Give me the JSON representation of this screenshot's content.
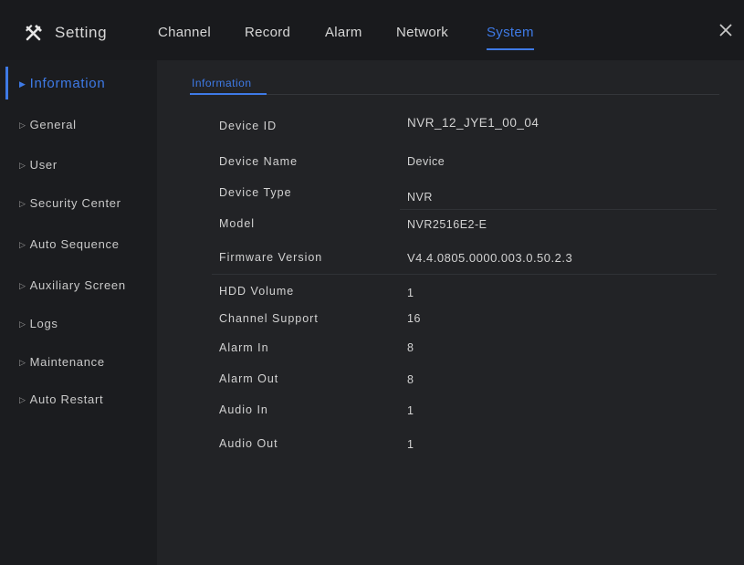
{
  "header": {
    "title": "Setting",
    "tabs": [
      {
        "label": "Channel"
      },
      {
        "label": "Record"
      },
      {
        "label": "Alarm"
      },
      {
        "label": "Network"
      },
      {
        "label": "System",
        "active": true
      }
    ]
  },
  "sidebar": {
    "items": [
      {
        "label": "Information",
        "active": true
      },
      {
        "label": "General"
      },
      {
        "label": "User"
      },
      {
        "label": "Security Center"
      },
      {
        "label": "Auto Sequence"
      },
      {
        "label": "Auxiliary Screen"
      },
      {
        "label": "Logs"
      },
      {
        "label": "Maintenance"
      },
      {
        "label": "Auto Restart"
      }
    ]
  },
  "main": {
    "subtab": "Information",
    "fields": [
      {
        "label": "Device ID",
        "value": "NVR_12_JYE1_00_04"
      },
      {
        "label": "Device Name",
        "value": "Device"
      },
      {
        "label": "Device Type",
        "value": "NVR"
      },
      {
        "label": "Model",
        "value": "NVR2516E2-E"
      },
      {
        "label": "Firmware Version",
        "value": "V4.4.0805.0000.003.0.50.2.3"
      },
      {
        "label": "HDD Volume",
        "value": "1"
      },
      {
        "label": "Channel Support",
        "value": "16"
      },
      {
        "label": "Alarm In",
        "value": "8"
      },
      {
        "label": "Alarm Out",
        "value": "8"
      },
      {
        "label": "Audio In",
        "value": "1"
      },
      {
        "label": "Audio Out",
        "value": "1"
      }
    ]
  },
  "colors": {
    "accent": "#3e7ae6",
    "background": "#1d1e21",
    "text": "#d2d2d2"
  },
  "icons": {
    "settings": "tools-icon",
    "close": "close-icon",
    "arrow": "triangle-right-icon"
  }
}
